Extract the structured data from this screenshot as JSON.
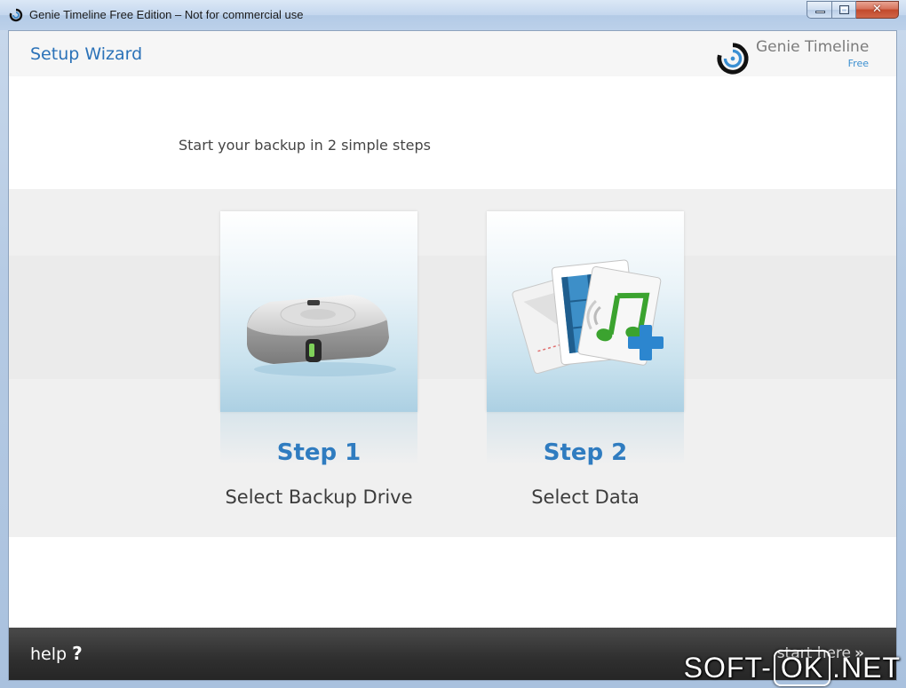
{
  "window": {
    "title": "Genie Timeline Free Edition – Not for commercial use",
    "close_symbol": "✕"
  },
  "header": {
    "title": "Setup Wizard",
    "brand_name": "Genie Timeline",
    "brand_edition": "Free"
  },
  "main": {
    "subtitle": "Start your backup in 2 simple steps",
    "steps": [
      {
        "number": "Step 1",
        "label": "Select Backup Drive",
        "icon": "hard-drive-icon"
      },
      {
        "number": "Step 2",
        "label": "Select Data",
        "icon": "add-files-icon"
      }
    ]
  },
  "footer": {
    "help_label": "help",
    "help_symbol": "?",
    "start_label": "start here",
    "start_symbol": "»"
  },
  "watermark": {
    "part1": "SOFT-",
    "part2": "OK",
    "part3": ".NET"
  },
  "colors": {
    "accent": "#2f7cc0",
    "title_blue": "#2b72b8",
    "footer_bg": "#2f2f2f"
  }
}
